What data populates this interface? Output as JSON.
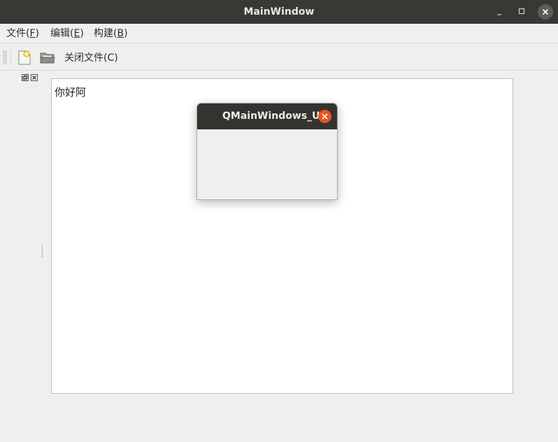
{
  "window": {
    "title": "MainWindow",
    "minimize_icon": "minimize-icon",
    "maximize_icon": "maximize-icon",
    "close_icon": "close-icon"
  },
  "menubar": {
    "items": [
      {
        "pre": "文件(",
        "mnemonic": "F",
        "post": ")"
      },
      {
        "pre": "编辑(",
        "mnemonic": "E",
        "post": ")"
      },
      {
        "pre": "构建(",
        "mnemonic": "B",
        "post": ")"
      }
    ]
  },
  "toolbar": {
    "new_icon": "new-file-icon",
    "open_icon": "open-folder-icon",
    "close_file_label": "关闭文件(C)"
  },
  "editor": {
    "text": "你好阿"
  },
  "dialog": {
    "title": "QMainWindows_Ui"
  },
  "colors": {
    "titlebar": "#3a3835",
    "dialog_close": "#e95420",
    "window_bg": "#efefef",
    "editor_bg": "#ffffff"
  }
}
